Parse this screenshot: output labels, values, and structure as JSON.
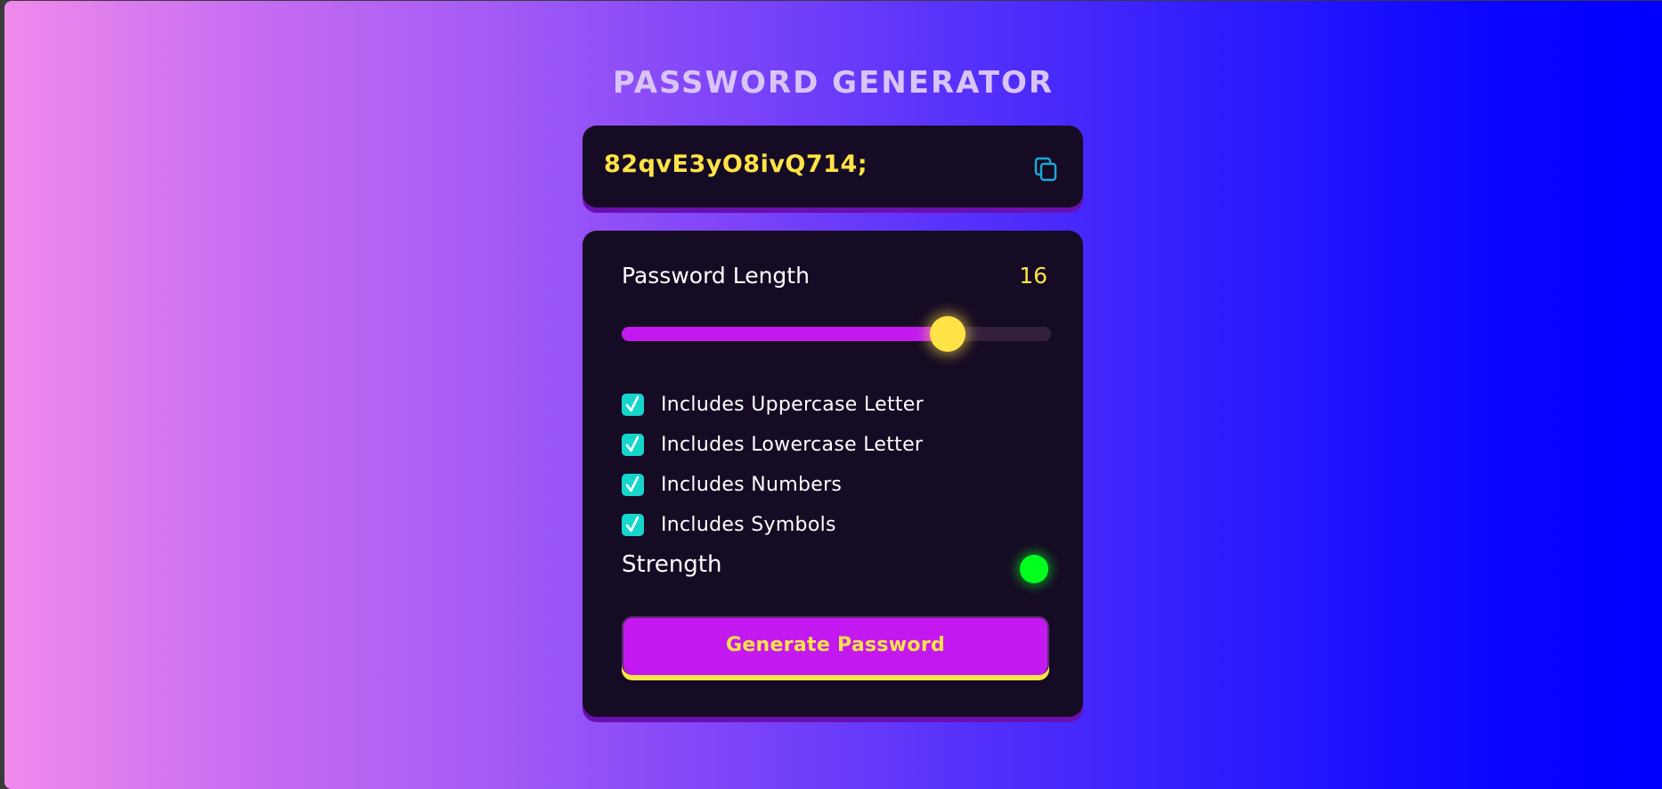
{
  "app": {
    "title": "PASSWORD GENERATOR"
  },
  "display": {
    "password": "82qvE3yO8ivQ714;",
    "copy_icon": "copy-icon"
  },
  "settings": {
    "length_label": "Password Length",
    "length_value": "16",
    "length_min": 1,
    "length_max": 20,
    "slider_fraction": 0.76,
    "options": [
      {
        "label": "Includes Uppercase Letter",
        "checked": true
      },
      {
        "label": "Includes Lowercase Letter",
        "checked": true
      },
      {
        "label": "Includes Numbers",
        "checked": true
      },
      {
        "label": "Includes Symbols",
        "checked": true
      }
    ],
    "strength_label": "Strength",
    "strength_color": "#00ff1e"
  },
  "actions": {
    "generate_label": "Generate Password"
  },
  "colors": {
    "accent_yellow": "#ffe347",
    "accent_magenta": "#c319f0",
    "checkbox_teal": "#16d6cc",
    "panel_bg": "#160b24"
  }
}
